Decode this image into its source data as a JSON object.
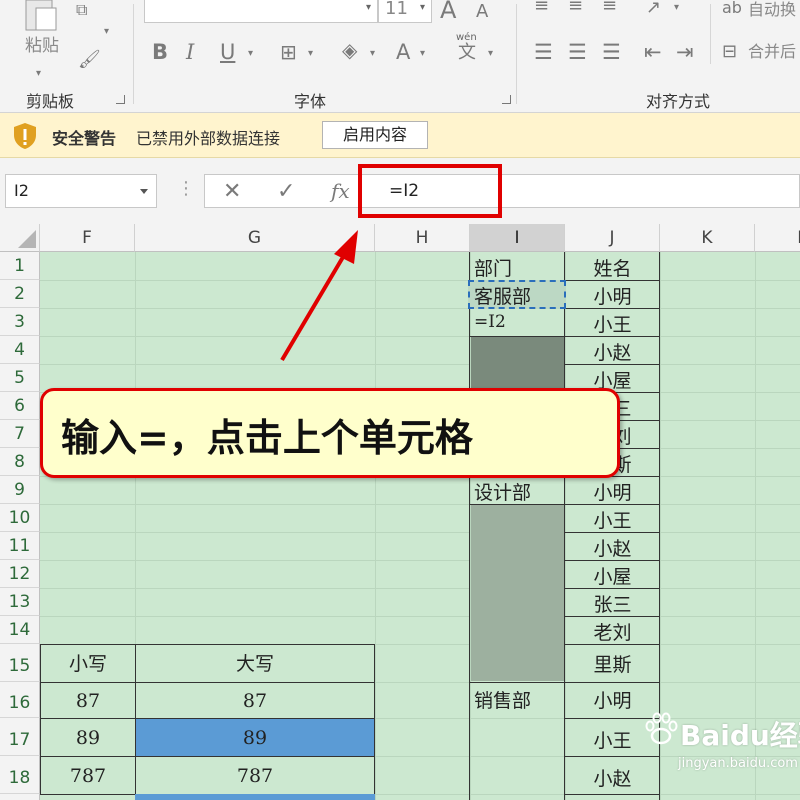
{
  "ribbon": {
    "paste_label": "粘贴",
    "font_size": "11",
    "clipboard_label": "剪贴板",
    "font_label": "字体",
    "align_label": "对齐方式",
    "wrap_label": "自动换",
    "merge_label": "合并后",
    "bold": "B",
    "italic": "I",
    "underline": "U",
    "font_color_glyph": "A",
    "pinyin_top": "wén",
    "pinyin_char": "文",
    "grow_glyph": "A",
    "shrink_glyph": "A"
  },
  "security_bar": {
    "title": "安全警告",
    "message": "已禁用外部数据连接",
    "button": "启用内容"
  },
  "formula_bar": {
    "name_box": "I2",
    "cancel": "✕",
    "enter": "✓",
    "fx": "fx",
    "formula": "=I2"
  },
  "columns": [
    "F",
    "G",
    "H",
    "I",
    "J",
    "K",
    "L"
  ],
  "rows": [
    "1",
    "2",
    "3",
    "4",
    "5",
    "6",
    "7",
    "8",
    "9",
    "10",
    "11",
    "12",
    "13",
    "14",
    "15",
    "16",
    "17",
    "18"
  ],
  "cells": {
    "I1": "部门",
    "I2": "客服部",
    "I3": "=I2",
    "I9": "设计部",
    "I16": "销售部",
    "J1": "姓名",
    "J2": "小明",
    "J3": "小王",
    "J4": "小赵",
    "J5": "小屋",
    "J6": "张三",
    "J7": "老刘",
    "J8": "里斯",
    "J9": "小明",
    "J10": "小王",
    "J11": "小赵",
    "J12": "小屋",
    "J13": "张三",
    "J14": "老刘",
    "J15": "里斯",
    "J16": "小明",
    "J17": "小王",
    "J18": "小赵",
    "F15": "小写",
    "G15": "大写",
    "F16": "87",
    "G16": "87",
    "F17": "89",
    "G17": "89",
    "F18": "787",
    "G18": "787"
  },
  "callout": "输入=，点击上个单元格",
  "watermark": {
    "brand": "Baidu经验",
    "url": "jingyan.baidu.com"
  },
  "colors": {
    "grid_bg": "#cce8d0",
    "shade_dark": "#7a8a7c",
    "shade_light": "#9db09f",
    "blue_fill": "#5b9bd5",
    "accent_red": "#e00000",
    "security_bg": "#fff4ce"
  }
}
